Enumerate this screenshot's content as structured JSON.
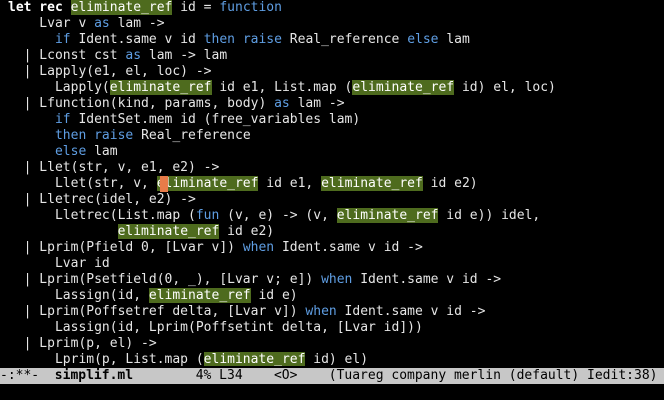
{
  "code_lines": [
    [
      {
        "t": "let rec ",
        "c": "kwb"
      },
      {
        "t": "eliminate_ref",
        "c": "hl"
      },
      {
        "t": " id = ",
        "c": "pl"
      },
      {
        "t": "function",
        "c": "kw"
      }
    ],
    [
      {
        "t": "    Lvar v ",
        "c": "pl"
      },
      {
        "t": "as",
        "c": "kw"
      },
      {
        "t": " lam ->",
        "c": "pl"
      }
    ],
    [
      {
        "t": "      ",
        "c": "pl"
      },
      {
        "t": "if",
        "c": "kw"
      },
      {
        "t": " Ident.same v id ",
        "c": "pl"
      },
      {
        "t": "then raise",
        "c": "kw"
      },
      {
        "t": " Real_reference ",
        "c": "pl"
      },
      {
        "t": "else",
        "c": "kw"
      },
      {
        "t": " lam",
        "c": "pl"
      }
    ],
    [
      {
        "t": "  | Lconst cst ",
        "c": "pl"
      },
      {
        "t": "as",
        "c": "kw"
      },
      {
        "t": " lam -> lam",
        "c": "pl"
      }
    ],
    [
      {
        "t": "  | Lapply(e1, el, loc) ->",
        "c": "pl"
      }
    ],
    [
      {
        "t": "      Lapply(",
        "c": "pl"
      },
      {
        "t": "eliminate_ref",
        "c": "hl"
      },
      {
        "t": " id e1, List.map (",
        "c": "pl"
      },
      {
        "t": "eliminate_ref",
        "c": "hl"
      },
      {
        "t": " id) el, loc)",
        "c": "pl"
      }
    ],
    [
      {
        "t": "  | Lfunction(kind, params, body) ",
        "c": "pl"
      },
      {
        "t": "as",
        "c": "kw"
      },
      {
        "t": " lam ->",
        "c": "pl"
      }
    ],
    [
      {
        "t": "      ",
        "c": "pl"
      },
      {
        "t": "if",
        "c": "kw"
      },
      {
        "t": " IdentSet.mem id (free_variables lam)",
        "c": "pl"
      }
    ],
    [
      {
        "t": "      ",
        "c": "pl"
      },
      {
        "t": "then raise",
        "c": "kw"
      },
      {
        "t": " Real_reference",
        "c": "pl"
      }
    ],
    [
      {
        "t": "      ",
        "c": "pl"
      },
      {
        "t": "else",
        "c": "kw"
      },
      {
        "t": " lam",
        "c": "pl"
      }
    ],
    [
      {
        "t": "  | Llet(str, v, e1, e2) ->",
        "c": "pl"
      }
    ],
    [
      {
        "t": "      Llet(str, v, ",
        "c": "pl"
      },
      {
        "t": "eliminate_ref",
        "c": "hl"
      },
      {
        "t": " id e1, ",
        "c": "pl"
      },
      {
        "t": "eliminate_ref",
        "c": "hl"
      },
      {
        "t": " id e2)",
        "c": "pl"
      }
    ],
    [
      {
        "t": "  | Lletrec(idel, e2) ->",
        "c": "pl"
      }
    ],
    [
      {
        "t": "      Lletrec(List.map (",
        "c": "pl"
      },
      {
        "t": "fun",
        "c": "kw"
      },
      {
        "t": " (v, e) -> (v, ",
        "c": "pl"
      },
      {
        "t": "eliminate_ref",
        "c": "hl"
      },
      {
        "t": " id e)) idel,",
        "c": "pl"
      }
    ],
    [
      {
        "t": "              ",
        "c": "pl"
      },
      {
        "t": "eliminate_ref",
        "c": "hl"
      },
      {
        "t": " id e2)",
        "c": "pl"
      }
    ],
    [
      {
        "t": "  | Lprim(Pfield 0, [Lvar v]) ",
        "c": "pl"
      },
      {
        "t": "when",
        "c": "kw"
      },
      {
        "t": " Ident.same v id ->",
        "c": "pl"
      }
    ],
    [
      {
        "t": "      Lvar id",
        "c": "pl"
      }
    ],
    [
      {
        "t": "  | Lprim(Psetfield(0, _), [Lvar v; e]) ",
        "c": "pl"
      },
      {
        "t": "when",
        "c": "kw"
      },
      {
        "t": " Ident.same v id ->",
        "c": "pl"
      }
    ],
    [
      {
        "t": "      Lassign(id, ",
        "c": "pl"
      },
      {
        "t": "eliminate_ref",
        "c": "hl"
      },
      {
        "t": " id e)",
        "c": "pl"
      }
    ],
    [
      {
        "t": "  | Lprim(Poffsetref delta, [Lvar v]) ",
        "c": "pl"
      },
      {
        "t": "when",
        "c": "kw"
      },
      {
        "t": " Ident.same v id ->",
        "c": "pl"
      }
    ],
    [
      {
        "t": "      Lassign(id, Lprim(Poffsetint delta, [Lvar id]))",
        "c": "pl"
      }
    ],
    [
      {
        "t": "  | Lprim(p, el) ->",
        "c": "pl"
      }
    ],
    [
      {
        "t": "      Lprim(p, List.map (",
        "c": "pl"
      },
      {
        "t": "eliminate_ref",
        "c": "hl"
      },
      {
        "t": " id) el)",
        "c": "pl"
      }
    ]
  ],
  "modeline": {
    "status": "-:**-  ",
    "buffer_name": "simplif.ml",
    "position": "        4% L34",
    "mode_info": "    <O>    (Tuareg company merlin (default) Iedit:38)"
  },
  "colors": {
    "background": "#000000",
    "keyword": "#5f9ee3",
    "highlight": "#4e6b1e",
    "cursor": "#e87b49",
    "modeline_bg": "#c7c7c7"
  }
}
